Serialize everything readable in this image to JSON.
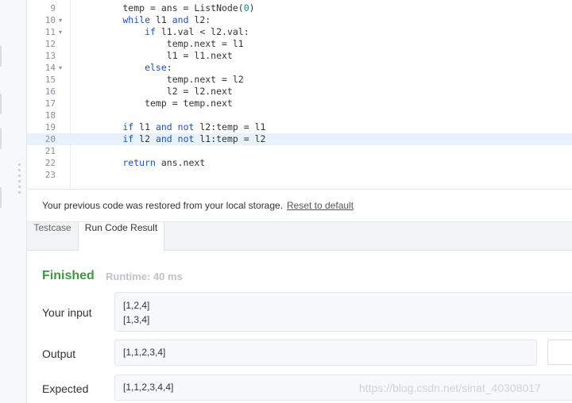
{
  "editor": {
    "lines": [
      {
        "n": "9",
        "fold": false,
        "tokens": [
          [
            "",
            "        temp = ans = ListNode("
          ],
          [
            "num",
            "0"
          ],
          [
            "",
            ")"
          ]
        ]
      },
      {
        "n": "10",
        "fold": true,
        "tokens": [
          [
            "kw",
            "        while"
          ],
          [
            "",
            " l1 "
          ],
          [
            "kw",
            "and"
          ],
          [
            "",
            " l2:"
          ]
        ]
      },
      {
        "n": "11",
        "fold": true,
        "tokens": [
          [
            "kw",
            "            if"
          ],
          [
            "",
            " l1.val < l2.val:"
          ]
        ]
      },
      {
        "n": "12",
        "fold": false,
        "tokens": [
          [
            "",
            "                temp.next = l1"
          ]
        ]
      },
      {
        "n": "13",
        "fold": false,
        "tokens": [
          [
            "",
            "                l1 = l1.next"
          ]
        ]
      },
      {
        "n": "14",
        "fold": true,
        "tokens": [
          [
            "kw",
            "            else"
          ],
          [
            "",
            ":"
          ]
        ]
      },
      {
        "n": "15",
        "fold": false,
        "tokens": [
          [
            "",
            "                temp.next = l2"
          ]
        ]
      },
      {
        "n": "16",
        "fold": false,
        "tokens": [
          [
            "",
            "                l2 = l2.next"
          ]
        ]
      },
      {
        "n": "17",
        "fold": false,
        "tokens": [
          [
            "",
            "            temp = temp.next"
          ]
        ]
      },
      {
        "n": "18",
        "fold": false,
        "tokens": []
      },
      {
        "n": "19",
        "fold": false,
        "tokens": [
          [
            "kw",
            "        if"
          ],
          [
            "",
            " l1 "
          ],
          [
            "kw",
            "and not"
          ],
          [
            "",
            " l2:temp = l1"
          ]
        ]
      },
      {
        "n": "20",
        "fold": false,
        "active": true,
        "tokens": [
          [
            "kw",
            "        if"
          ],
          [
            "",
            " l2 "
          ],
          [
            "kw",
            "and not"
          ],
          [
            "",
            " l1:temp = l2"
          ]
        ]
      },
      {
        "n": "21",
        "fold": false,
        "tokens": []
      },
      {
        "n": "22",
        "fold": false,
        "tokens": [
          [
            "kw",
            "        return"
          ],
          [
            "",
            " ans.next"
          ]
        ]
      },
      {
        "n": "23",
        "fold": false,
        "tokens": []
      }
    ],
    "fold_glyph": "▾"
  },
  "notice": {
    "text": "Your previous code was restored from your local storage.",
    "reset_link": "Reset to default"
  },
  "tabs": {
    "testcase": "Testcase",
    "run_result": "Run Code Result"
  },
  "result": {
    "status": "Finished",
    "runtime": "Runtime: 40 ms",
    "input_label": "Your input",
    "input_lines": [
      "[1,2,4]",
      "[1,3,4]"
    ],
    "output_label": "Output",
    "output_value": "[1,1,2,3,4]",
    "expected_label": "Expected",
    "expected_value": "[1,1,2,3,4,4]"
  },
  "watermark": "https://blog.csdn.net/sinat_40308017",
  "colors": {
    "keyword": "#1a4fcf",
    "number": "#0b8a8a",
    "status_ok": "#3b9a3b",
    "active_line": "#e8f2fc"
  }
}
